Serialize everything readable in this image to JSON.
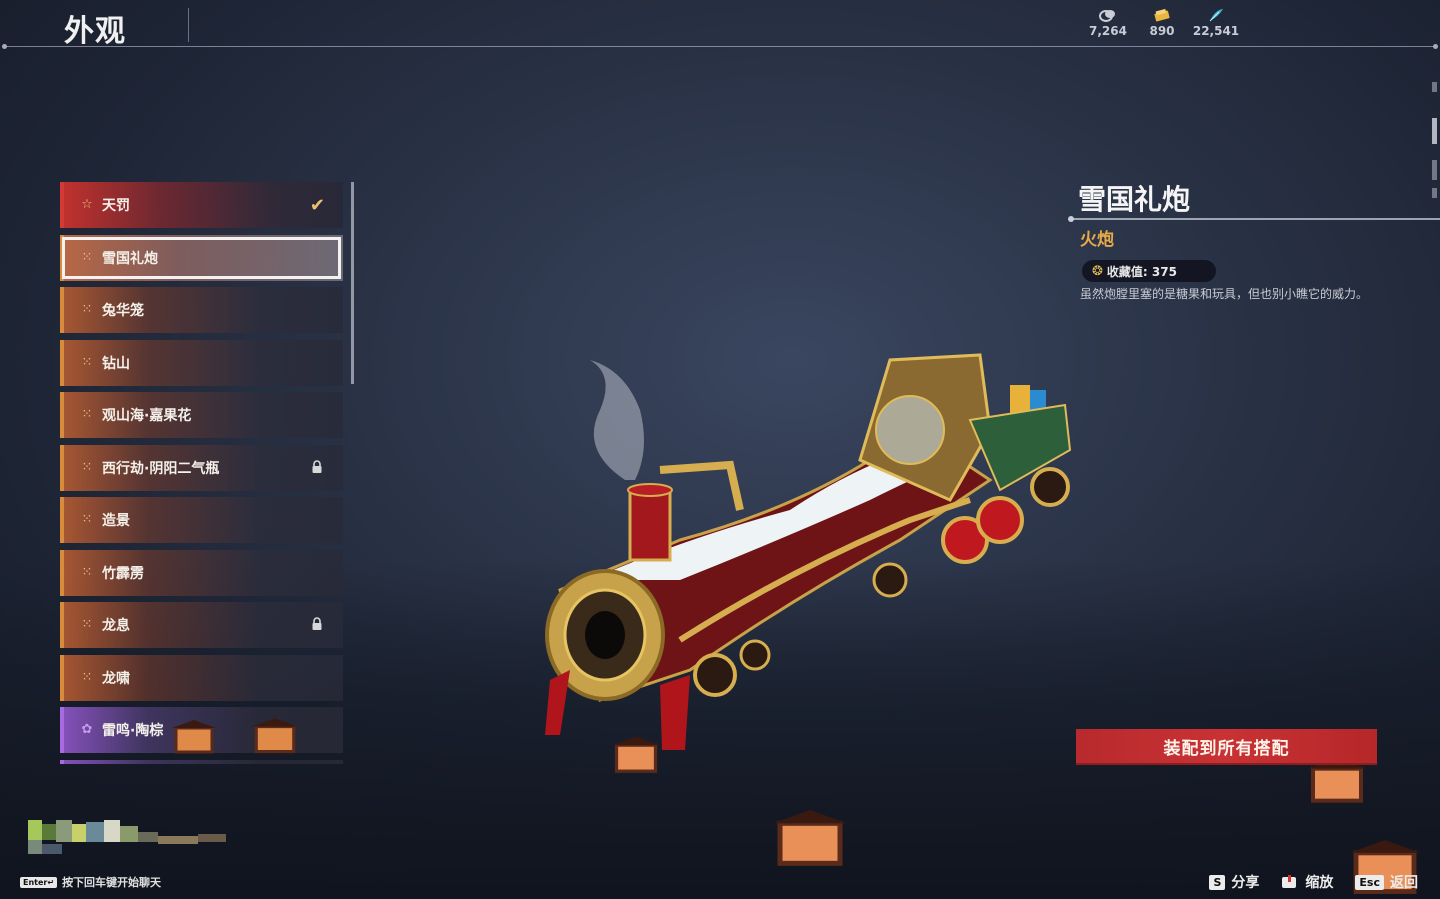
{
  "header": {
    "title": "外观"
  },
  "currencies": [
    {
      "icon": "coin-stack-icon",
      "value": "7,264"
    },
    {
      "icon": "gold-ticket-icon",
      "value": "890"
    },
    {
      "icon": "cyan-feather-icon",
      "value": "22,541"
    }
  ],
  "skin_list": {
    "items": [
      {
        "label": "天罚",
        "icon": "star-outline-icon",
        "state": "equipped",
        "locked": false
      },
      {
        "label": "雪国礼炮",
        "icon": "quad-dot-icon",
        "state": "selected",
        "locked": false
      },
      {
        "label": "兔华笼",
        "icon": "quad-dot-icon",
        "state": "normal",
        "locked": false
      },
      {
        "label": "钻山",
        "icon": "quad-dot-icon",
        "state": "normal",
        "locked": false
      },
      {
        "label": "观山海·嘉果花",
        "icon": "quad-dot-icon",
        "state": "normal",
        "locked": false
      },
      {
        "label": "西行劫·阴阳二气瓶",
        "icon": "quad-dot-icon",
        "state": "normal",
        "locked": true
      },
      {
        "label": "造景",
        "icon": "quad-dot-icon",
        "state": "normal",
        "locked": false
      },
      {
        "label": "竹霹雳",
        "icon": "quad-dot-icon",
        "state": "normal",
        "locked": false
      },
      {
        "label": "龙息",
        "icon": "quad-dot-icon",
        "state": "normal",
        "locked": true
      },
      {
        "label": "龙啸",
        "icon": "quad-dot-icon",
        "state": "normal",
        "locked": false
      },
      {
        "label": "雷鸣·陶棕",
        "icon": "triple-petal-icon",
        "state": "purple",
        "locked": false
      }
    ]
  },
  "detail": {
    "name": "雪国礼炮",
    "type": "火炮",
    "collect_label": "收藏值: 375",
    "description": "虽然炮膛里塞的是糖果和玩具，但也别小瞧它的威力。"
  },
  "equip_button": {
    "label": "装配到所有搭配"
  },
  "chat": {
    "key": "Enter↵",
    "hint": "按下回车键开始聊天"
  },
  "hints": [
    {
      "key": "S",
      "label": "分享"
    },
    {
      "key_icon": "mouse-icon",
      "label": "缩放"
    },
    {
      "key": "Esc",
      "label": "返回"
    }
  ],
  "colors": {
    "accent_orange": "#d88b3a",
    "equip_red": "#c93235",
    "type_gold": "#e8a948"
  }
}
